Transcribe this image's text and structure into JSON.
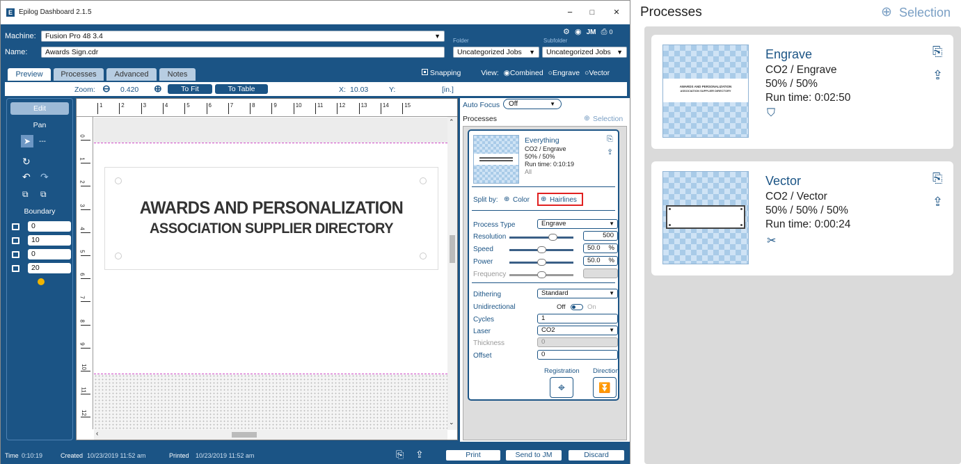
{
  "window": {
    "title": "Epilog Dashboard 2.1.5",
    "minimize": "−",
    "maximize": "□",
    "close": "✕"
  },
  "header": {
    "machine_label": "Machine:",
    "machine_value": "Fusion Pro 48 3.4",
    "name_label": "Name:",
    "name_value": "Awards Sign.cdr",
    "folder_label": "Folder",
    "folder_value": "Uncategorized Jobs",
    "subfolder_label": "Subfolder",
    "subfolder_value": "Uncategorized Jobs",
    "jm_label": "JM",
    "counter": "0"
  },
  "tabs": [
    "Preview",
    "Processes",
    "Advanced",
    "Notes"
  ],
  "viewbar": {
    "snapping": "Snapping",
    "view_label": "View:",
    "combined": "Combined",
    "engrave": "Engrave",
    "vector": "Vector"
  },
  "toolbar": {
    "zoom_label": "Zoom:",
    "zoom_value": "0.420",
    "to_fit": "To Fit",
    "to_table": "To Table",
    "x_label": "X:",
    "x_value": "10.03",
    "y_label": "Y:",
    "units": "[in.]"
  },
  "left": {
    "edit": "Edit",
    "pan": "Pan",
    "pan_value": "---",
    "boundary": "Boundary",
    "fields": [
      "0",
      "10",
      "0",
      "20"
    ]
  },
  "canvas": {
    "line1": "AWARDS AND PERSONALIZATION",
    "line2": "ASSOCIATION SUPPLIER DIRECTORY",
    "hticks": [
      "1",
      "2",
      "3",
      "4",
      "5",
      "6",
      "7",
      "8",
      "9",
      "10",
      "11",
      "12",
      "13",
      "14",
      "15"
    ],
    "vticks": [
      "0",
      "1",
      "2",
      "3",
      "4",
      "5",
      "6",
      "7",
      "8",
      "9",
      "10",
      "11",
      "12"
    ]
  },
  "right": {
    "autofocus_label": "Auto Focus",
    "autofocus_value": "Off",
    "processes_label": "Processes",
    "selection_label": "Selection",
    "proc_name": "Everything",
    "proc_type": "CO2 / Engrave",
    "proc_pct": "50% / 50%",
    "proc_run": "Run time: 0:10:19",
    "proc_all": "All",
    "split_label": "Split by:",
    "split_color": "Color",
    "split_hairlines": "Hairlines",
    "ptype_label": "Process Type",
    "ptype_value": "Engrave",
    "res_label": "Resolution",
    "res_value": "500",
    "speed_label": "Speed",
    "speed_value": "50.0",
    "power_label": "Power",
    "power_value": "50.0",
    "pct": "%",
    "freq_label": "Frequency",
    "dither_label": "Dithering",
    "dither_value": "Standard",
    "unidir_label": "Unidirectional",
    "off": "Off",
    "on": "On",
    "cycles_label": "Cycles",
    "cycles_value": "1",
    "laser_label": "Laser",
    "laser_value": "CO2",
    "thick_label": "Thickness",
    "thick_value": "0",
    "offset_label": "Offset",
    "offset_value": "0",
    "registration": "Registration",
    "direction": "Direction"
  },
  "status": {
    "time_label": "Time",
    "time_value": "0:10:19",
    "created_label": "Created",
    "created_value": "10/23/2019 11:52 am",
    "printed_label": "Printed",
    "printed_value": "10/23/2019 11:52 am",
    "print": "Print",
    "send": "Send to JM",
    "discard": "Discard"
  },
  "processes_panel": {
    "title": "Processes",
    "selection": "Selection",
    "cards": [
      {
        "name": "Engrave",
        "type": "CO2 / Engrave",
        "pct": "50% / 50%",
        "run": "Run time: 0:02:50",
        "thumb_l1": "AWARDS AND PERSONALIZATION",
        "thumb_l2": "ASSOCIATION SUPPLIER DIRECTORY"
      },
      {
        "name": "Vector",
        "type": "CO2 / Vector",
        "pct": "50% / 50% / 50%",
        "run": "Run time: 0:00:24"
      }
    ]
  },
  "colors": {
    "brand": "#1b5485",
    "highlight": "#e02020",
    "guide": "#d04cc8"
  }
}
